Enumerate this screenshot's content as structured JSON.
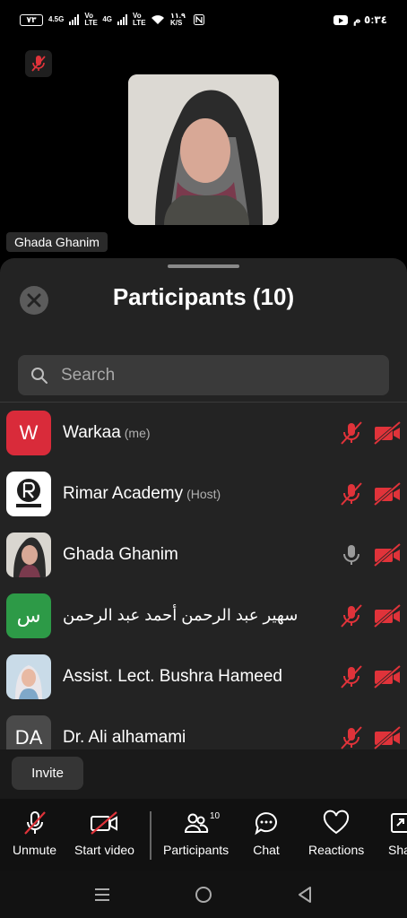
{
  "status_bar": {
    "battery": "٧٣",
    "net1": "4.5G",
    "lte1": "Vo LTE",
    "net2": "4G",
    "lte2": "Vo LTE",
    "speed": "١١.٩ K/S",
    "time": "٥:٣٤ م"
  },
  "speaker": {
    "name": "Ghada Ghanim"
  },
  "participants_panel": {
    "title": "Participants (10)",
    "search_placeholder": "Search",
    "invite_label": "Invite",
    "participants": [
      {
        "name": "Warkaa",
        "role": "(me)",
        "avatar_text": "W",
        "avatar_color": "#d92b3a",
        "mic": "muted",
        "video": "off"
      },
      {
        "name": "Rimar Academy",
        "role": "(Host)",
        "avatar_text": "",
        "avatar_color": "#ffffff",
        "mic": "muted",
        "video": "off"
      },
      {
        "name": "Ghada Ghanim",
        "role": "",
        "avatar_text": "",
        "avatar_color": "#d9d6d0",
        "mic": "on",
        "video": "off"
      },
      {
        "name": "سهير عبد الرحمن أحمد عبد الرحمن",
        "role": "",
        "avatar_text": "س",
        "avatar_color": "#2d9a47",
        "mic": "muted",
        "video": "off"
      },
      {
        "name": "Assist. Lect. Bushra Hameed",
        "role": "",
        "avatar_text": "",
        "avatar_color": "#c9dbe8",
        "mic": "muted",
        "video": "off"
      },
      {
        "name": "Dr. Ali alhamami",
        "role": "",
        "avatar_text": "DA",
        "avatar_color": "#4a4a4a",
        "mic": "muted",
        "video": "off"
      }
    ]
  },
  "toolbar": {
    "unmute_label": "Unmute",
    "start_video_label": "Start video",
    "participants_label": "Participants",
    "participants_count": "10",
    "chat_label": "Chat",
    "reactions_label": "Reactions",
    "share_label": "Share"
  },
  "colors": {
    "muted_red": "#e0333a",
    "sheet_bg": "#232323"
  }
}
